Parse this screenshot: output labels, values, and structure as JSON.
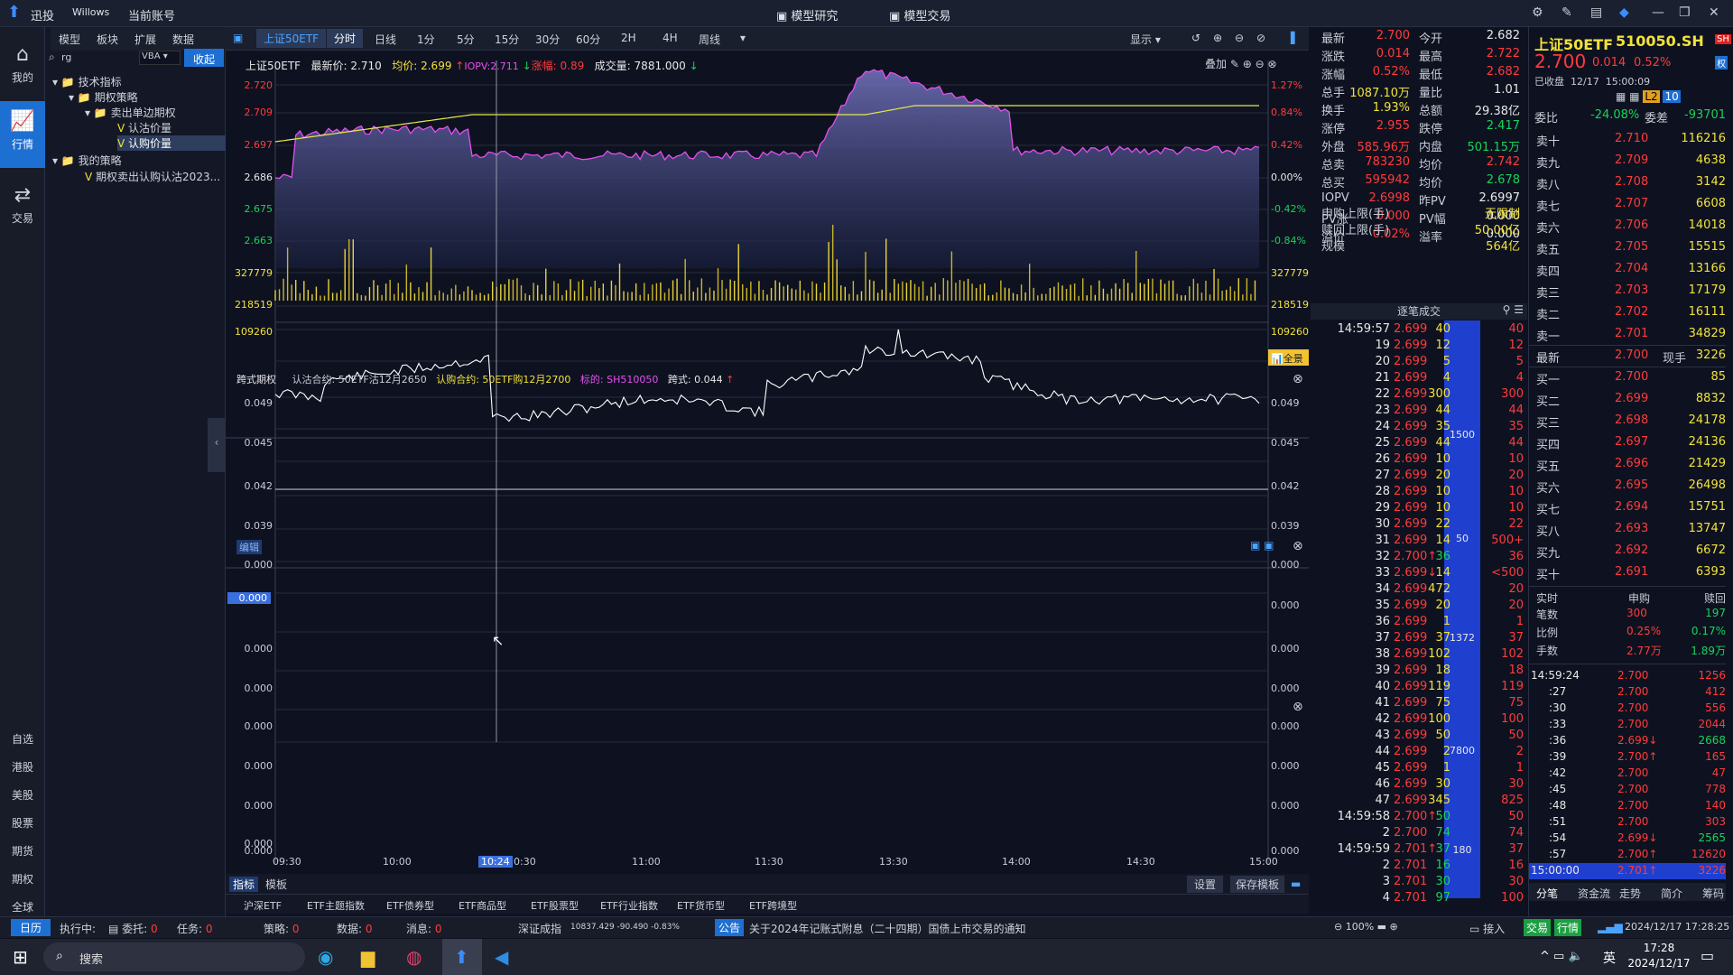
{
  "titlebar": {
    "app": "迅投",
    "user": "Willows",
    "account": "当前账号",
    "center_tabs": [
      "模型研究",
      "模型交易"
    ]
  },
  "leftnav": {
    "items": [
      "我的",
      "行情",
      "交易"
    ],
    "bottom": [
      "自选",
      "港股",
      "美股",
      "股票",
      "期货",
      "期权",
      "全球"
    ]
  },
  "tree": {
    "tabs": [
      "模型",
      "板块",
      "扩展",
      "数据"
    ],
    "search_value": "rg",
    "lang": "VBA",
    "collapse_btn": "收起",
    "nodes": [
      "技术指标",
      "期权策略",
      "卖出单边期权",
      "认沽价量",
      "认购价量",
      "我的策略",
      "期权卖出认购认沽2023..."
    ]
  },
  "toolbar": {
    "symbol_tab": "上证50ETF",
    "periods": [
      "分时",
      "日线",
      "1分",
      "5分",
      "15分",
      "30分",
      "60分",
      "2H",
      "4H",
      "周线"
    ],
    "display": "显示"
  },
  "chart": {
    "header": {
      "name": "上证50ETF",
      "last_label": "最新价:",
      "last": "2.710",
      "avg_label": "均价:",
      "avg": "2.699",
      "iopv": "IOPV:2.711",
      "chg_label": "涨幅:",
      "chg": "0.89",
      "vol_label": "成交量:",
      "vol": "7881.000"
    },
    "overlay": "叠加",
    "price_axis_left": [
      "2.720",
      "2.709",
      "2.697",
      "2.686",
      "2.675",
      "2.663"
    ],
    "price_axis_right": [
      "1.27%",
      "0.84%",
      "0.42%",
      "0.00%",
      "-0.42%",
      "-0.84%"
    ],
    "vol_axis": [
      "327779",
      "218519",
      "109260"
    ],
    "full": "全景",
    "time_axis": [
      "09:30",
      "10:00",
      "10:30",
      "11:00",
      "11:30",
      "13:30",
      "14:00",
      "14:30",
      "15:00"
    ],
    "cursor_time": "10:24",
    "kuashi": {
      "label": "跨式期权",
      "put_label": "认沽合约:",
      "put": "50ETF沽12月2650",
      "call_label": "认购合约:",
      "call": "50ETF购12月2700",
      "under_label": "标的:",
      "under": "SH510050",
      "kuashi_label": "跨式:",
      "kuashi": "0.044",
      "axis": [
        "0.049",
        "0.045",
        "0.042",
        "0.039"
      ]
    },
    "edit_label": "编辑",
    "zero_axis": [
      "0.000",
      "0.000",
      "0.000",
      "0.000"
    ],
    "cursor_val": "0.000",
    "zero_axis2": [
      "0.000",
      "0.000",
      "0.000",
      "0.000",
      "0.000"
    ]
  },
  "bottomtabs": {
    "left": [
      "指标",
      "模板"
    ],
    "right": [
      "设置",
      "保存模板"
    ]
  },
  "etf_tabs": [
    "沪深ETF",
    "ETF主题指数",
    "ETF债券型",
    "ETF商品型",
    "ETF股票型",
    "ETF行业指数",
    "ETF货币型",
    "ETF跨境型"
  ],
  "info": {
    "rows": [
      [
        "最新",
        "2.700",
        "今开",
        "2.682"
      ],
      [
        "涨跌",
        "0.014",
        "最高",
        "2.722"
      ],
      [
        "涨幅",
        "0.52%",
        "最低",
        "2.682"
      ],
      [
        "总手",
        "1087.10万",
        "量比",
        "1.01"
      ],
      [
        "换手",
        "1.93%",
        "总额",
        "29.38亿"
      ],
      [
        "涨停",
        "2.955",
        "跌停",
        "2.417"
      ],
      [
        "外盘",
        "585.96万",
        "内盘",
        "501.15万"
      ],
      [
        "总卖",
        "783230",
        "均价",
        "2.742"
      ],
      [
        "总买",
        "595942",
        "均价",
        "2.678"
      ],
      [
        "IOPV",
        "2.6998",
        "昨PV",
        "2.6997"
      ],
      [
        "PV涨",
        "0.000",
        "PV幅",
        "0.000"
      ],
      [
        "溢价",
        "0.02%",
        "溢率",
        "0.000"
      ]
    ],
    "shengou_label": "申购上限(手)",
    "shengou": "无限制",
    "shuhui_label": "赎回上限(手)",
    "shuhui": "50.00亿",
    "guimo_label": "规模",
    "guimo": "564亿",
    "zhubi": "逐笔成交"
  },
  "quote": {
    "name": "上证50ETF",
    "code": "510050.SH",
    "market": "SH",
    "price": "2.700",
    "chg": "0.014",
    "pct": "0.52%",
    "status": "已收盘",
    "date": "12/17",
    "time": "15:00:09",
    "weibi_label": "委比",
    "weibi": "-24.08%",
    "weicha_label": "委差",
    "weicha": "-93701",
    "asks": [
      [
        "卖十",
        "2.710",
        "116216"
      ],
      [
        "卖九",
        "2.709",
        "4638"
      ],
      [
        "卖八",
        "2.708",
        "3142"
      ],
      [
        "卖七",
        "2.707",
        "6608"
      ],
      [
        "卖六",
        "2.706",
        "14018"
      ],
      [
        "卖五",
        "2.705",
        "15515"
      ],
      [
        "卖四",
        "2.704",
        "13166"
      ],
      [
        "卖三",
        "2.703",
        "17179"
      ],
      [
        "卖二",
        "2.702",
        "16111"
      ],
      [
        "卖一",
        "2.701",
        "34829"
      ]
    ],
    "last_label": "最新",
    "last": "2.700",
    "hand_label": "现手",
    "hand": "3226",
    "bids": [
      [
        "买一",
        "2.700",
        "85"
      ],
      [
        "买二",
        "2.699",
        "8832"
      ],
      [
        "买三",
        "2.698",
        "24178"
      ],
      [
        "买四",
        "2.697",
        "24136"
      ],
      [
        "买五",
        "2.696",
        "21429"
      ],
      [
        "买六",
        "2.695",
        "26498"
      ],
      [
        "买七",
        "2.694",
        "15751"
      ],
      [
        "买八",
        "2.693",
        "13747"
      ],
      [
        "买九",
        "2.692",
        "6672"
      ],
      [
        "买十",
        "2.691",
        "6393"
      ]
    ],
    "rt_head": [
      "实时",
      "申购",
      "赎回"
    ],
    "rt": [
      [
        "笔数",
        "300",
        "197"
      ],
      [
        "比例",
        "0.25%",
        "0.17%"
      ],
      [
        "手数",
        "2.77万",
        "1.89万"
      ]
    ],
    "trades": [
      [
        "14:59:24",
        "2.700",
        "1256"
      ],
      [
        ":27",
        "2.700",
        "412"
      ],
      [
        ":30",
        "2.700",
        "556"
      ],
      [
        ":33",
        "2.700",
        "2044"
      ],
      [
        ":36",
        "2.699↓",
        "2668"
      ],
      [
        ":39",
        "2.700↑",
        "165"
      ],
      [
        ":42",
        "2.700",
        "47"
      ],
      [
        ":45",
        "2.700",
        "778"
      ],
      [
        ":48",
        "2.700",
        "140"
      ],
      [
        ":51",
        "2.700",
        "303"
      ],
      [
        ":54",
        "2.699↓",
        "2565"
      ],
      [
        ":57",
        "2.700↑",
        "12620"
      ],
      [
        "15:00:00",
        "2.701↑",
        "3226"
      ]
    ],
    "bottom_tabs": [
      "分笔",
      "资金流",
      "走势",
      "简介",
      "筹码"
    ]
  },
  "ticks": [
    [
      "14:59:57",
      "2.699",
      "40",
      "40"
    ],
    [
      "19",
      "2.699",
      "12",
      "12"
    ],
    [
      "20",
      "2.699",
      "5",
      "5"
    ],
    [
      "21",
      "2.699",
      "4",
      "4"
    ],
    [
      "22",
      "2.699",
      "300",
      "300"
    ],
    [
      "23",
      "2.699",
      "44",
      "44"
    ],
    [
      "24",
      "2.699",
      "35",
      "35"
    ],
    [
      "25",
      "2.699",
      "44",
      "44"
    ],
    [
      "26",
      "2.699",
      "10",
      "10"
    ],
    [
      "27",
      "2.699",
      "20",
      "20"
    ],
    [
      "28",
      "2.699",
      "10",
      "10"
    ],
    [
      "29",
      "2.699",
      "10",
      "10"
    ],
    [
      "30",
      "2.699",
      "22",
      "22"
    ],
    [
      "31",
      "2.699",
      "14",
      "500+"
    ],
    [
      "32",
      "2.700↑",
      "36",
      "36"
    ],
    [
      "33",
      "2.699↓",
      "14",
      "<500"
    ],
    [
      "34",
      "2.699",
      "472",
      "20"
    ],
    [
      "35",
      "2.699",
      "20",
      "20"
    ],
    [
      "36",
      "2.699",
      "1",
      "1"
    ],
    [
      "37",
      "2.699",
      "37",
      "37"
    ],
    [
      "38",
      "2.699",
      "102",
      "102"
    ],
    [
      "39",
      "2.699",
      "18",
      "18"
    ],
    [
      "40",
      "2.699",
      "119",
      "119"
    ],
    [
      "41",
      "2.699",
      "75",
      "75"
    ],
    [
      "42",
      "2.699",
      "100",
      "100"
    ],
    [
      "43",
      "2.699",
      "50",
      "50"
    ],
    [
      "44",
      "2.699",
      "2",
      "2"
    ],
    [
      "45",
      "2.699",
      "1",
      "1"
    ],
    [
      "46",
      "2.699",
      "30",
      "30"
    ],
    [
      "47",
      "2.699",
      "345",
      "825"
    ],
    [
      "14:59:58",
      "2.700↑",
      "50",
      "50"
    ],
    [
      "2",
      "2.700",
      "74",
      "74"
    ],
    [
      "14:59:59",
      "2.701↑",
      "37",
      "37"
    ],
    [
      "2",
      "2.701",
      "16",
      "16"
    ],
    [
      "3",
      "2.701",
      "30",
      "30"
    ],
    [
      "4",
      "2.701",
      "97",
      "100"
    ]
  ],
  "tick_blue": [
    "1500",
    "50",
    "1372",
    "7800",
    "180"
  ],
  "status": {
    "cal": "日历",
    "exec_label": "执行中:",
    "weituo_label": "委托:",
    "weituo": "0",
    "task_label": "任务:",
    "task": "0",
    "strat_label": "策略:",
    "strat": "0",
    "data_label": "数据:",
    "data": "0",
    "msg_label": "消息:",
    "msg": "0",
    "index_name": "深证成指",
    "index_val": "10837.429 -90.490 -0.83%",
    "notice_tag": "公告",
    "notice": "关于2024年记账式附息（二十四期）国债上市交易的通知",
    "zoom": "100%",
    "jieru": "接入",
    "jy": "交易",
    "hq": "行情",
    "datetime": "2024/12/17 17:28:25"
  },
  "taskbar": {
    "search": "搜索",
    "ime": "英",
    "time": "17:28",
    "date": "2024/12/17"
  }
}
